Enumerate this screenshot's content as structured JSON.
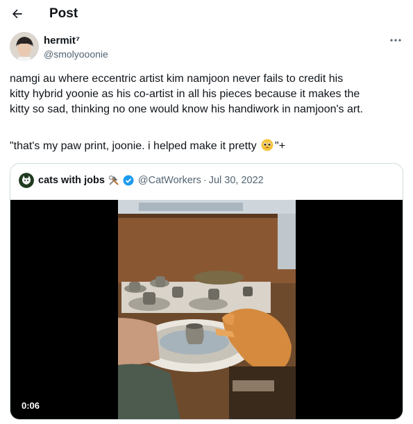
{
  "header": {
    "back_icon": "arrow-left-icon",
    "title": "Post"
  },
  "author": {
    "display_name": "hermit⁷",
    "handle": "@smolyooonie",
    "more_icon": "more-horizontal-icon"
  },
  "tweet": {
    "lines": [
      "namgi au where eccentric artist kim namjoon never fails to credit his",
      "kitty hybrid yoonie as his co-artist in all his pieces because it makes the",
      "kitty so sad, thinking no one would know his handiwork in namjoon's art."
    ],
    "quote_before": "\"that's my paw print, joonie. i helped make it pretty ",
    "quote_emoji": "pleading-face-emoji",
    "quote_after": "\"+"
  },
  "quoted": {
    "name": "cats with jobs",
    "tools_icon": "hammer-and-wrench-icon",
    "verified_icon": "verified-badge-icon",
    "handle": "@CatWorkers",
    "separator": "·",
    "date": "Jul 30, 2022",
    "video": {
      "duration": "0:06",
      "description_icon": "video-thumbnail"
    }
  },
  "colors": {
    "text": "#0f1419",
    "muted": "#536471",
    "border": "#cfd9de",
    "verified": "#1d9bf0"
  }
}
